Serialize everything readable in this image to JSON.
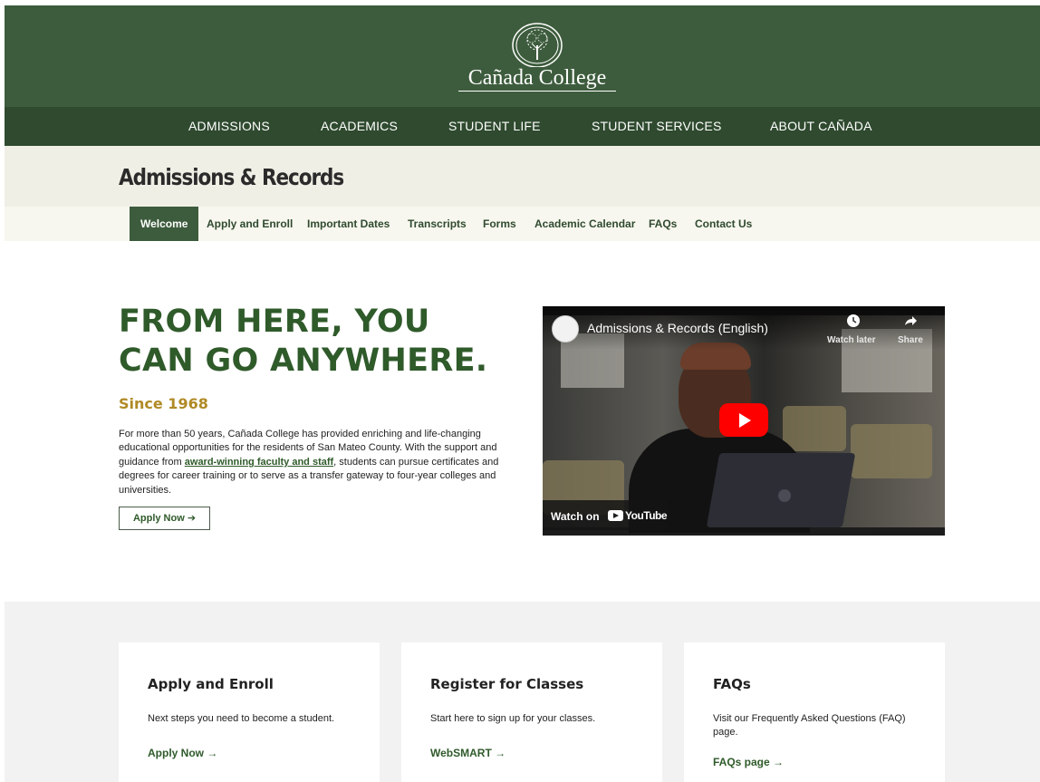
{
  "header": {
    "logo_text": "Cañada College"
  },
  "main_nav": [
    {
      "label": "ADMISSIONS"
    },
    {
      "label": "ACADEMICS"
    },
    {
      "label": "STUDENT LIFE"
    },
    {
      "label": "STUDENT SERVICES"
    },
    {
      "label": "ABOUT CAÑADA"
    }
  ],
  "section": {
    "title": "Admissions & Records"
  },
  "sub_nav": [
    {
      "label": "Welcome",
      "active": true
    },
    {
      "label": "Apply and Enroll"
    },
    {
      "label": "Important Dates"
    },
    {
      "label": "Transcripts"
    },
    {
      "label": "Forms"
    },
    {
      "label": "Academic Calendar"
    },
    {
      "label": "FAQs"
    },
    {
      "label": "Contact Us"
    }
  ],
  "hero": {
    "title_line1": "FROM HERE, YOU",
    "title_line2": "CAN GO ANYWHERE.",
    "subtitle": "Since 1968",
    "body_before": "For more than 50 years, Cañada College has provided enriching and life-changing educational opportunities for the residents of San Mateo County. With the support and guidance from ",
    "body_link": "award-winning faculty and staff",
    "body_after": ", students can pursue certificates and degrees for career training or to serve as a transfer gateway to four-year colleges and universities.",
    "button_label": "Apply Now ➔"
  },
  "video": {
    "title": "Admissions & Records (English)",
    "watch_later": "Watch later",
    "share": "Share",
    "watch_on": "Watch on",
    "youtube": "YouTube"
  },
  "cards": [
    {
      "title": "Apply and Enroll",
      "text": "Next steps you need to become a student.",
      "link": "Apply Now →"
    },
    {
      "title": "Register for Classes",
      "text": "Start here to sign up for your classes.",
      "link": "WebSMART →"
    },
    {
      "title": "FAQs",
      "text": "Visit our Frequently Asked Questions (FAQ) page.",
      "link": "FAQs page →"
    }
  ],
  "colors": {
    "header_green": "#3d5c3d",
    "nav_green": "#2f4a2f",
    "headline_green": "#2f5a2a",
    "gold": "#b08a26",
    "youtube_red": "#ff0000"
  }
}
